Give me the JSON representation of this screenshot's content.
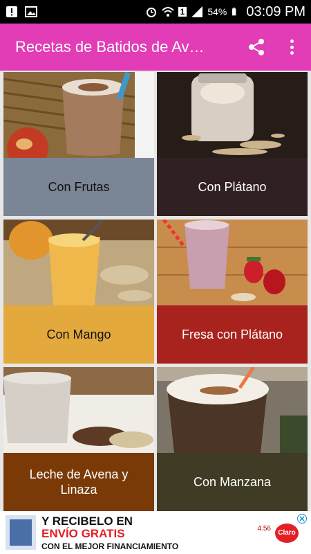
{
  "status_bar": {
    "battery": "54%",
    "time": "03:09 PM",
    "signal_badge": "1"
  },
  "app_bar": {
    "title": "Recetas de Batidos de Av…"
  },
  "recipes": [
    {
      "label": "Con Frutas",
      "label_bg": "#7a8696",
      "label_color": "#111111"
    },
    {
      "label": "Con Plátano",
      "label_bg": "#302022",
      "label_color": "#ffffff"
    },
    {
      "label": "Con Mango",
      "label_bg": "#e3a93d",
      "label_color": "#111111"
    },
    {
      "label": "Fresa con Plátano",
      "label_bg": "#a8231e",
      "label_color": "#ffffff"
    },
    {
      "label": "Leche de Avena y Linaza",
      "label_bg": "#7a3a07",
      "label_color": "#ffffff"
    },
    {
      "label": "Con Manzana",
      "label_bg": "#3f3b25",
      "label_color": "#ffffff"
    }
  ],
  "ad": {
    "line1": "Y RECIBELO EN",
    "line2": "ENVÍO GRATIS",
    "line3": "CON EL MEJOR FINANCIAMIENTO",
    "brand": "Claro",
    "price": "4.56"
  }
}
